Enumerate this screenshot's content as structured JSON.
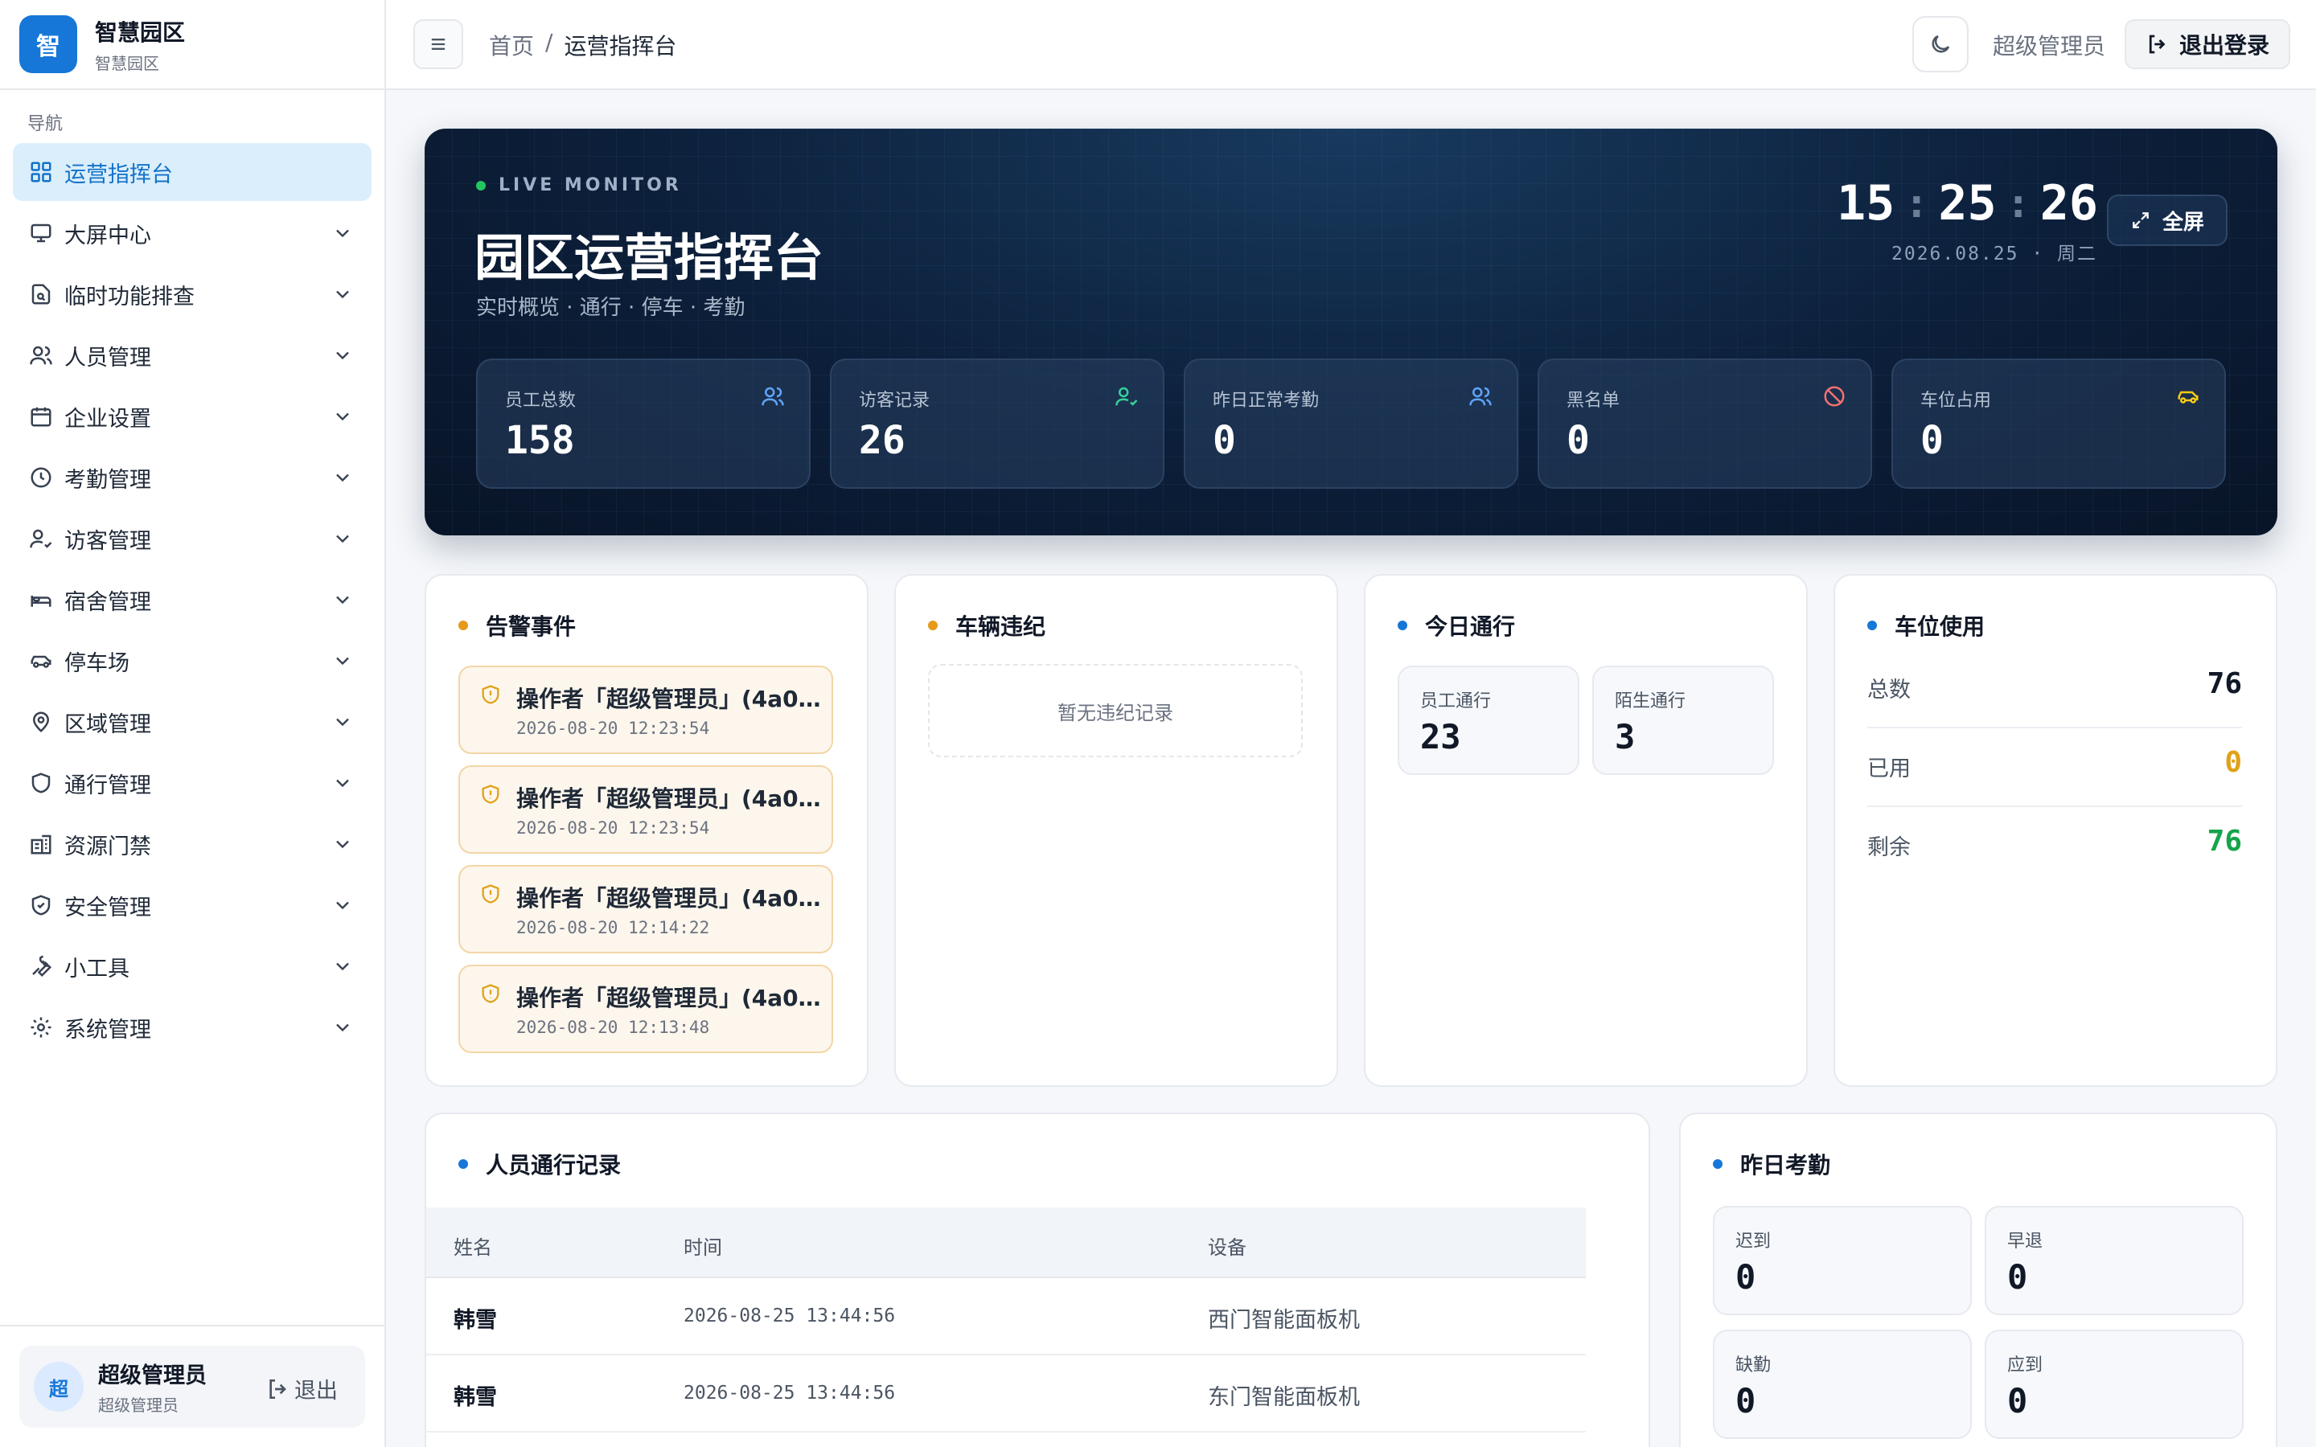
{
  "brand": {
    "logo": "智",
    "title": "智慧园区",
    "subtitle": "智慧园区"
  },
  "sidebar": {
    "caption": "导航",
    "items": [
      {
        "label": "运营指挥台",
        "icon": "dashboard-icon",
        "active": true
      },
      {
        "label": "大屏中心",
        "icon": "monitor-icon"
      },
      {
        "label": "临时功能排查",
        "icon": "file-search-icon"
      },
      {
        "label": "人员管理",
        "icon": "users-icon"
      },
      {
        "label": "企业设置",
        "icon": "calendar-icon"
      },
      {
        "label": "考勤管理",
        "icon": "clock-icon"
      },
      {
        "label": "访客管理",
        "icon": "user-check-icon"
      },
      {
        "label": "宿舍管理",
        "icon": "bed-icon"
      },
      {
        "label": "停车场",
        "icon": "car-icon"
      },
      {
        "label": "区域管理",
        "icon": "map-pin-icon"
      },
      {
        "label": "通行管理",
        "icon": "shield-icon"
      },
      {
        "label": "资源门禁",
        "icon": "building-icon"
      },
      {
        "label": "安全管理",
        "icon": "shield-check-icon"
      },
      {
        "label": "小工具",
        "icon": "wrench-icon"
      },
      {
        "label": "系统管理",
        "icon": "gear-icon"
      }
    ],
    "user": {
      "avatar": "超",
      "name": "超级管理员",
      "role": "超级管理员",
      "logout": "退出"
    }
  },
  "header": {
    "breadcrumb": {
      "home": "首页",
      "sep": "/",
      "current": "运营指挥台"
    },
    "role": "超级管理员",
    "logout": "退出登录"
  },
  "hero": {
    "live": "LIVE MONITOR",
    "title": "园区运营指挥台",
    "subtitle": "实时概览 · 通行 · 停车 · 考勤",
    "clock": {
      "h": "15",
      "m": "25",
      "s": "26",
      "sep": ":"
    },
    "date": "2026.08.25 · 周二",
    "fullscreen": "全屏",
    "stats": [
      {
        "label": "员工总数",
        "value": "158",
        "icon": "users-icon",
        "color": "#60a5fa"
      },
      {
        "label": "访客记录",
        "value": "26",
        "icon": "user-check-icon",
        "color": "#34d399"
      },
      {
        "label": "昨日正常考勤",
        "value": "0",
        "icon": "users-icon",
        "color": "#60a5fa"
      },
      {
        "label": "黑名单",
        "value": "0",
        "icon": "ban-icon",
        "color": "#f87171"
      },
      {
        "label": "车位占用",
        "value": "0",
        "icon": "car-icon",
        "color": "#facc15"
      }
    ]
  },
  "alarms": {
    "title": "告警事件",
    "items": [
      {
        "text": "操作者「超级管理员」(4a0...",
        "time": "2026-08-20 12:23:54"
      },
      {
        "text": "操作者「超级管理员」(4a0...",
        "time": "2026-08-20 12:23:54"
      },
      {
        "text": "操作者「超级管理员」(4a0...",
        "time": "2026-08-20 12:14:22"
      },
      {
        "text": "操作者「超级管理员」(4a0...",
        "time": "2026-08-20 12:13:48"
      }
    ]
  },
  "violations": {
    "title": "车辆违纪",
    "empty": "暂无违纪记录"
  },
  "traffic": {
    "title": "今日通行",
    "cards": [
      {
        "label": "员工通行",
        "value": "23"
      },
      {
        "label": "陌生通行",
        "value": "3"
      }
    ]
  },
  "parking": {
    "title": "车位使用",
    "rows": [
      {
        "label": "总数",
        "value": "76",
        "color": "#111827"
      },
      {
        "label": "已用",
        "value": "0",
        "color": "#e0a21b"
      },
      {
        "label": "剩余",
        "value": "76",
        "color": "#16a34a"
      }
    ]
  },
  "passRecords": {
    "title": "人员通行记录",
    "columns": [
      "姓名",
      "时间",
      "设备"
    ],
    "rows": [
      {
        "name": "韩雪",
        "time": "2026-08-25 13:44:56",
        "device": "西门智能面板机"
      },
      {
        "name": "韩雪",
        "time": "2026-08-25 13:44:56",
        "device": "东门智能面板机"
      }
    ]
  },
  "attendance": {
    "title": "昨日考勤",
    "cards": [
      {
        "label": "迟到",
        "value": "0"
      },
      {
        "label": "早退",
        "value": "0"
      },
      {
        "label": "缺勤",
        "value": "0"
      },
      {
        "label": "应到",
        "value": "0"
      }
    ]
  },
  "colors": {
    "accent": "#1677d8",
    "alarmDot": "#e59a1a",
    "warn": "#e0a21b",
    "success": "#16a34a"
  }
}
